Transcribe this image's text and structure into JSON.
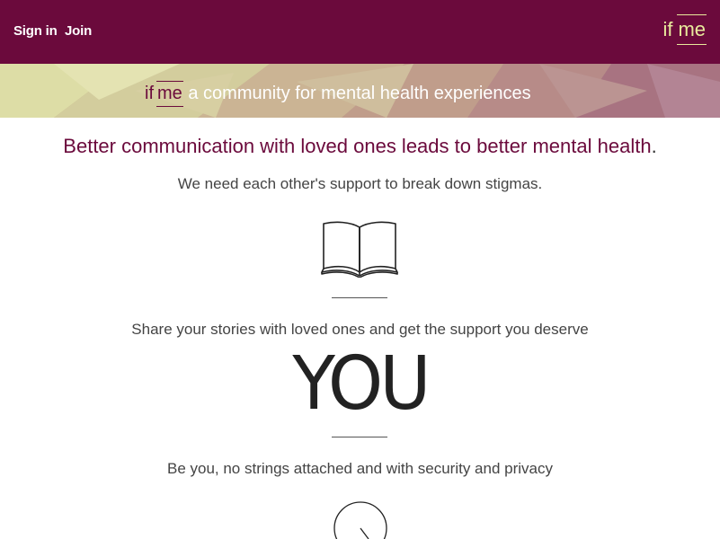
{
  "header": {
    "sign_in": "Sign in",
    "join": "Join",
    "logo_if": "if",
    "logo_me": "me"
  },
  "banner": {
    "if": "if",
    "me": "me",
    "text": " a community for mental health experiences"
  },
  "main": {
    "headline": "Better communication with loved ones leads to better mental health",
    "headline_punct": ".",
    "sub1": "We need each other's support to break down stigmas.",
    "sub2": "Share your stories with loved ones and get the support you deserve",
    "you_text": "YOU",
    "sub3": "Be you, no strings attached and with security and privacy"
  },
  "icons": [
    "book-icon",
    "clock-icon"
  ],
  "colors": {
    "brand": "#6b0a3c",
    "accent": "#e8ea9c"
  }
}
